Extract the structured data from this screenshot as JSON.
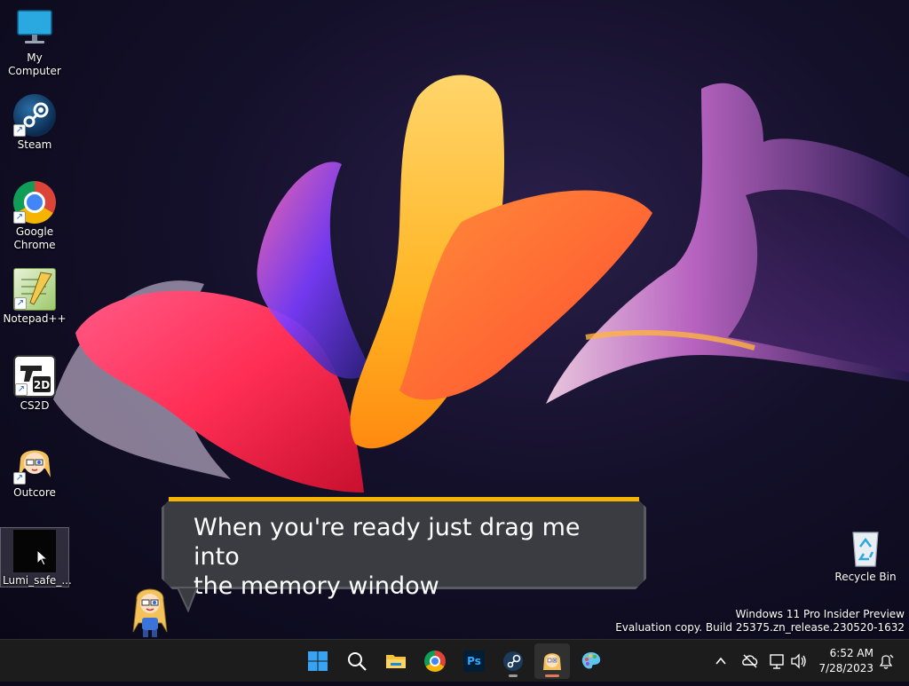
{
  "desktop": {
    "icons": [
      {
        "label": "My Computer",
        "icon": "monitor-icon"
      },
      {
        "label": "Steam",
        "icon": "steam-icon"
      },
      {
        "label": "Google Chrome",
        "icon": "chrome-icon"
      },
      {
        "label": "Notepad++",
        "icon": "notepad-plus-plus-icon"
      },
      {
        "label": "CS2D",
        "icon": "cs2d-icon"
      },
      {
        "label": "Outcore",
        "icon": "outcore-icon"
      },
      {
        "label": "Lumi_safe_...",
        "icon": "black-file-icon"
      }
    ],
    "recycle_bin": {
      "label": "Recycle Bin",
      "icon": "recycle-bin-icon"
    }
  },
  "dialog": {
    "line1": "When you're ready just drag me into",
    "line2": "the memory window",
    "accent_color": "#f5b400"
  },
  "watermark": {
    "line1": "Windows 11 Pro Insider Preview",
    "line2": "Evaluation copy. Build 25375.zn_release.230520-1632"
  },
  "taskbar": {
    "apps": [
      "start-icon",
      "search-icon",
      "file-explorer-icon",
      "chrome-icon",
      "photoshop-icon",
      "steam-icon",
      "outcore-icon",
      "paint-palette-icon"
    ],
    "photoshop_label": "Ps",
    "clock": {
      "time": "6:52 AM",
      "date": "7/28/2023"
    }
  }
}
